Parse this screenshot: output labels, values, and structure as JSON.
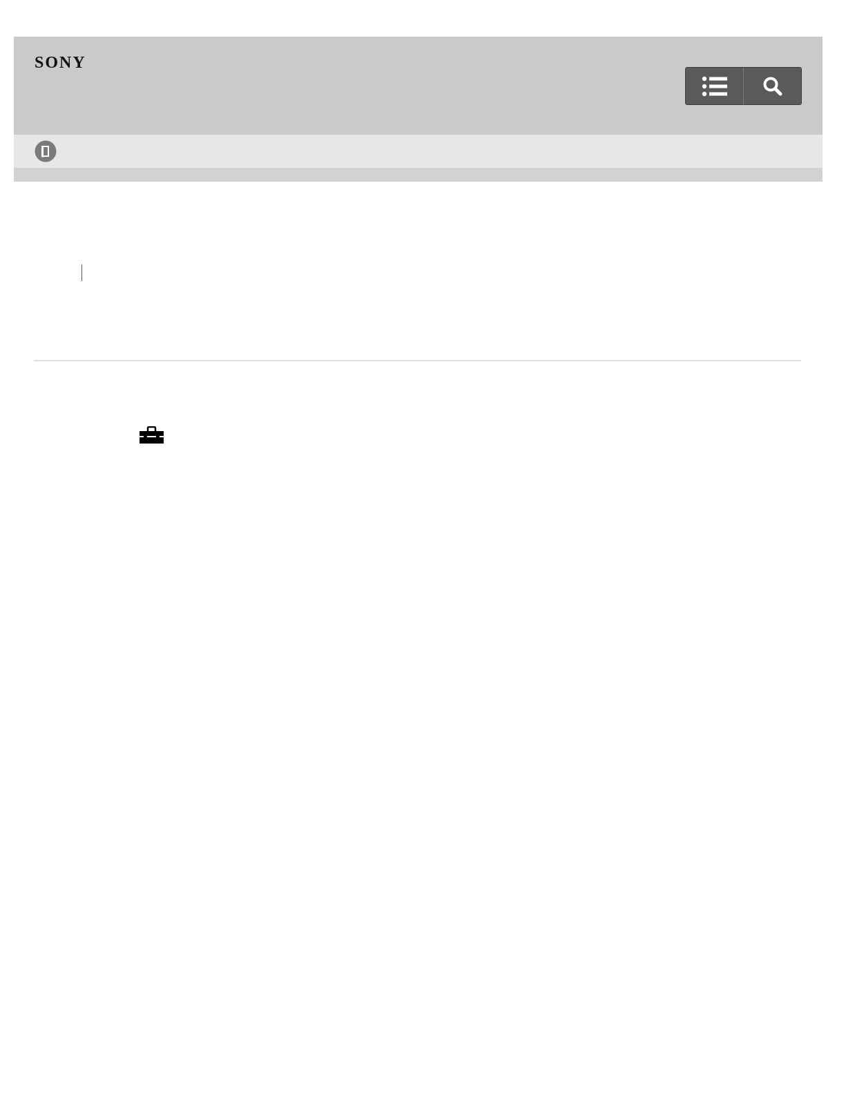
{
  "header": {
    "brand": "SONY",
    "buttons": [
      {
        "icon": "list-icon"
      },
      {
        "icon": "search-icon"
      }
    ]
  },
  "subbar": {
    "icon": "manual-book-icon"
  },
  "content": {
    "icons": [
      "toolbox-icon"
    ]
  },
  "colors": {
    "header_bg": "#cacaca",
    "subbar_bg": "#e7e7e7",
    "button_bg": "#5a5a5a",
    "icon_fg": "#ffffff"
  }
}
